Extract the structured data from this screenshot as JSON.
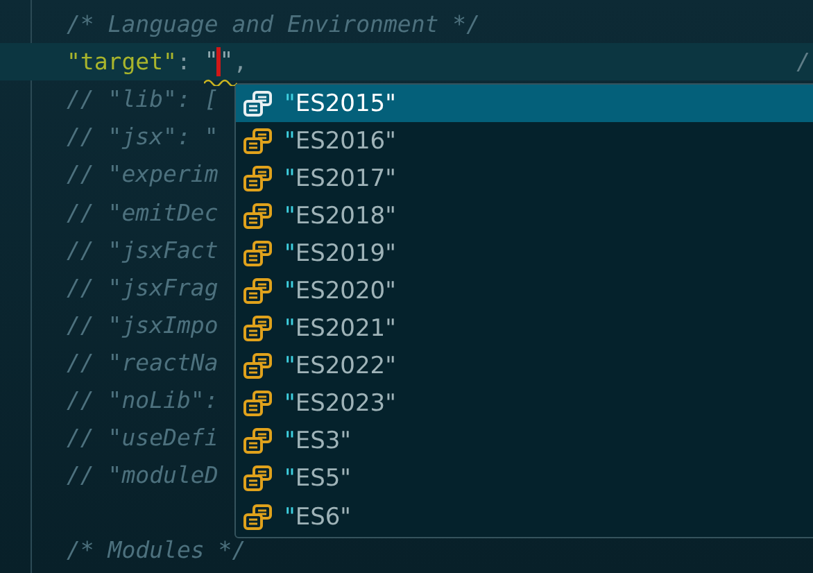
{
  "editor": {
    "lines": [
      {
        "kind": "comment",
        "text": "/* Language and Environment */"
      },
      {
        "kind": "property",
        "key": "\"target\"",
        "colon": ":",
        "value_open": "\"",
        "value_close": "\"",
        "trailing": ",",
        "end_text": "/",
        "current": true
      },
      {
        "kind": "comment",
        "text": "// \"lib\": ["
      },
      {
        "kind": "comment",
        "text": "// \"jsx\": \""
      },
      {
        "kind": "comment",
        "text": "// \"experim"
      },
      {
        "kind": "comment",
        "text": "// \"emitDec"
      },
      {
        "kind": "comment",
        "text": "// \"jsxFact"
      },
      {
        "kind": "comment",
        "text": "// \"jsxFrag"
      },
      {
        "kind": "comment",
        "text": "// \"jsxImpo"
      },
      {
        "kind": "comment",
        "text": "// \"reactNa"
      },
      {
        "kind": "comment",
        "text": "// \"noLib\":"
      },
      {
        "kind": "comment",
        "text": "// \"useDefi"
      },
      {
        "kind": "comment",
        "text": "// \"moduleD"
      },
      {
        "kind": "blank"
      },
      {
        "kind": "comment",
        "text": "/* Modules */"
      }
    ]
  },
  "suggestions": {
    "items": [
      {
        "quote": "\"",
        "label": "ES2015\"",
        "selected": true
      },
      {
        "quote": "\"",
        "label": "ES2016\"",
        "selected": false
      },
      {
        "quote": "\"",
        "label": "ES2017\"",
        "selected": false
      },
      {
        "quote": "\"",
        "label": "ES2018\"",
        "selected": false
      },
      {
        "quote": "\"",
        "label": "ES2019\"",
        "selected": false
      },
      {
        "quote": "\"",
        "label": "ES2020\"",
        "selected": false
      },
      {
        "quote": "\"",
        "label": "ES2021\"",
        "selected": false
      },
      {
        "quote": "\"",
        "label": "ES2022\"",
        "selected": false
      },
      {
        "quote": "\"",
        "label": "ES2023\"",
        "selected": false
      },
      {
        "quote": "\"",
        "label": "ES3\"",
        "selected": false
      },
      {
        "quote": "\"",
        "label": "ES5\"",
        "selected": false
      },
      {
        "quote": "\"",
        "label": "ES6\"",
        "selected": false
      }
    ]
  }
}
